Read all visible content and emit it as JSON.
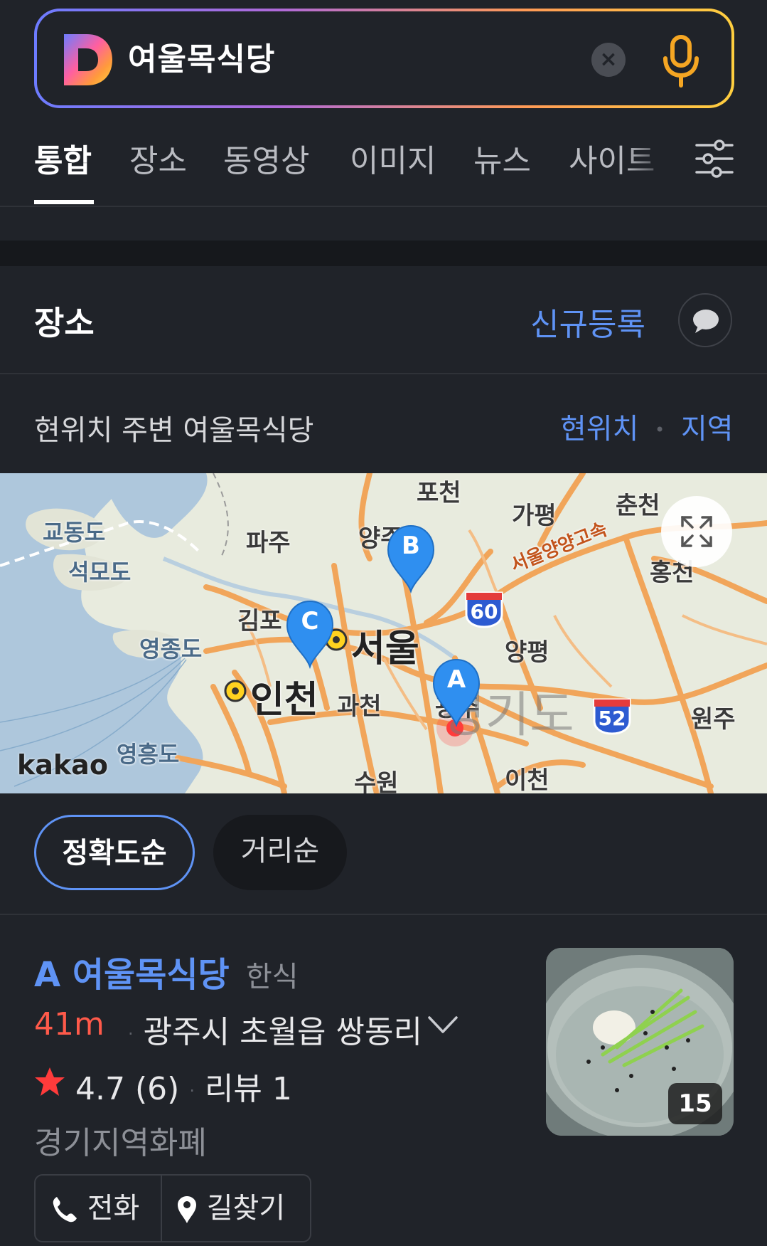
{
  "search": {
    "query": "여울목식당",
    "clear_icon": "close-icon",
    "voice_icon": "mic-icon",
    "border_gradient": [
      "#6d7cff",
      "#b06ad9",
      "#ff9a56",
      "#ffcf3f"
    ]
  },
  "tabs": [
    {
      "label": "통합",
      "active": true
    },
    {
      "label": "장소",
      "active": false
    },
    {
      "label": "동영상",
      "active": false
    },
    {
      "label": "이미지",
      "active": false
    },
    {
      "label": "뉴스",
      "active": false
    },
    {
      "label": "사이트",
      "active": false
    }
  ],
  "place_section": {
    "title": "장소",
    "new_register": "신규등록",
    "nearby_text": "현위치 주변 여울목식당",
    "current_location": "현위치",
    "region": "지역"
  },
  "map": {
    "labels": [
      "포천",
      "가평",
      "춘천",
      "교동도",
      "석모도",
      "파주",
      "양주",
      "홍천",
      "김포",
      "서울",
      "영종도",
      "인천",
      "과천",
      "양평",
      "광주",
      "경기도",
      "원주",
      "영흥도",
      "수원",
      "이천",
      "서울양양고속"
    ],
    "markers": [
      "A",
      "B",
      "C"
    ],
    "routes": [
      "60",
      "52"
    ],
    "brand": "kakao"
  },
  "sort": {
    "accuracy": "정확도순",
    "distance": "거리순",
    "selected": "정확도순"
  },
  "result": {
    "letter": "A",
    "name": "여울목식당",
    "category": "한식",
    "distance": "41m",
    "address": "광주시 초월읍 쌍동리",
    "rating": "4.7",
    "rating_count": "(6)",
    "review": "리뷰 1",
    "tag": "경기지역화폐",
    "photo_count": "15",
    "call_label": "전화",
    "directions_label": "길찾기"
  },
  "colors": {
    "accent": "#5f93f5",
    "distance": "#ff5a4a",
    "background": "#202329"
  }
}
